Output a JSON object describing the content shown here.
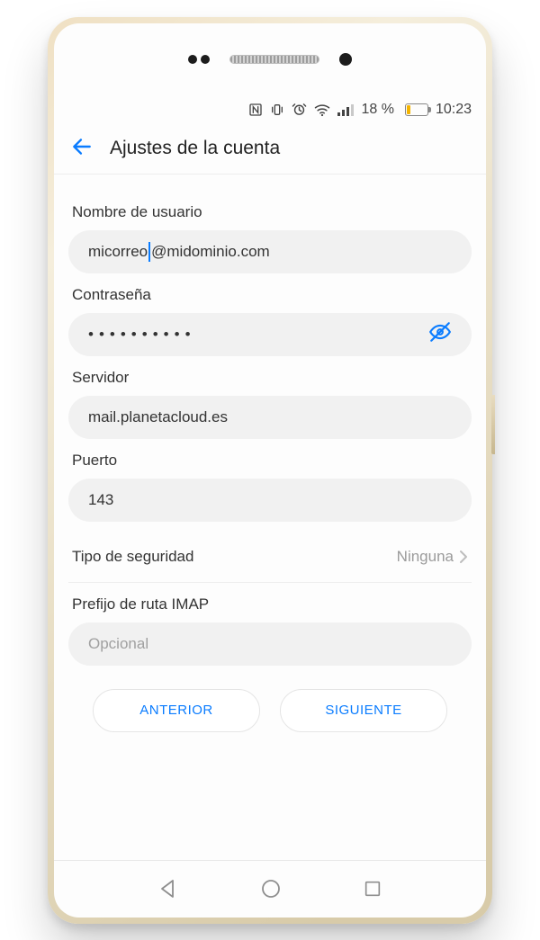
{
  "status": {
    "battery_pct": "18 %",
    "time": "10:23"
  },
  "appbar": {
    "title": "Ajustes de la cuenta"
  },
  "form": {
    "username_label": "Nombre de usuario",
    "username_value_a": "micorreo",
    "username_value_b": "@midominio.com",
    "password_label": "Contraseña",
    "password_masked": "••••••••••",
    "server_label": "Servidor",
    "server_value": "mail.planetacloud.es",
    "port_label": "Puerto",
    "port_value": "143",
    "security_label": "Tipo de seguridad",
    "security_value": "Ninguna",
    "imapprefix_label": "Prefijo de ruta IMAP",
    "imapprefix_placeholder": "Opcional"
  },
  "buttons": {
    "prev": "ANTERIOR",
    "next": "SIGUIENTE"
  }
}
